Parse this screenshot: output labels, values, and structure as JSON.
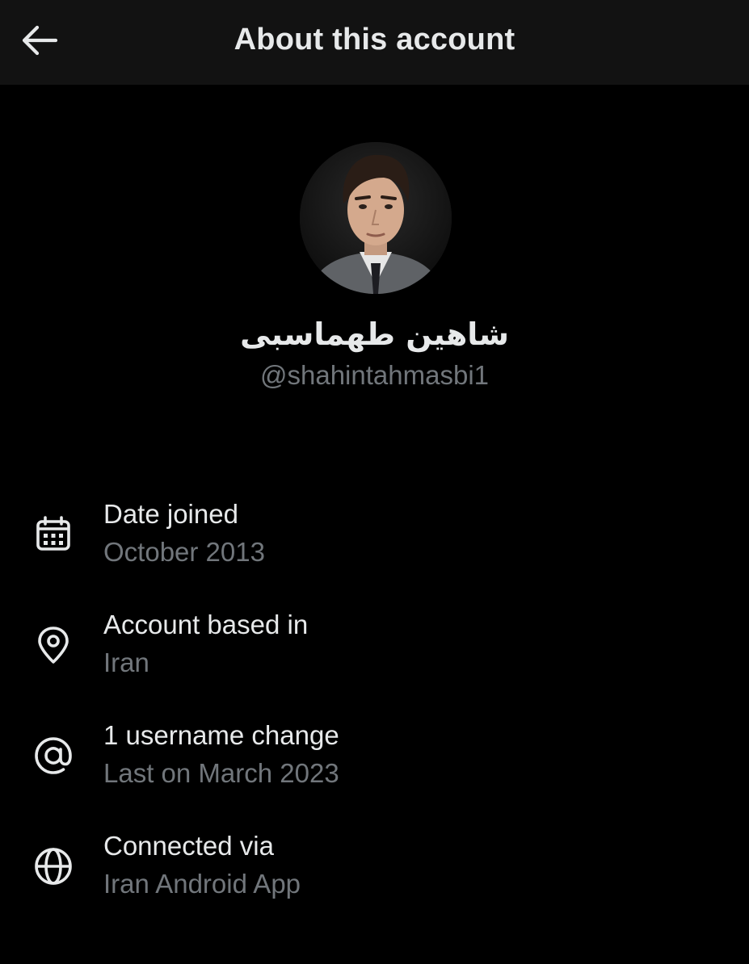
{
  "header": {
    "title": "About this account",
    "back_icon": "arrow-left-icon"
  },
  "profile": {
    "display_name": "شاهین طهماسبی",
    "handle": "@shahintahmasbi1"
  },
  "info": [
    {
      "icon": "calendar-icon",
      "label": "Date joined",
      "value": "October 2013"
    },
    {
      "icon": "location-pin-icon",
      "label": "Account based in",
      "value": "Iran"
    },
    {
      "icon": "at-sign-icon",
      "label": "1 username change",
      "value": "Last on March 2023"
    },
    {
      "icon": "globe-icon",
      "label": "Connected via",
      "value": "Iran Android App"
    }
  ],
  "colors": {
    "background": "#000000",
    "header_background": "#121212",
    "primary_text": "#e7e9ea",
    "secondary_text": "#71767b"
  }
}
